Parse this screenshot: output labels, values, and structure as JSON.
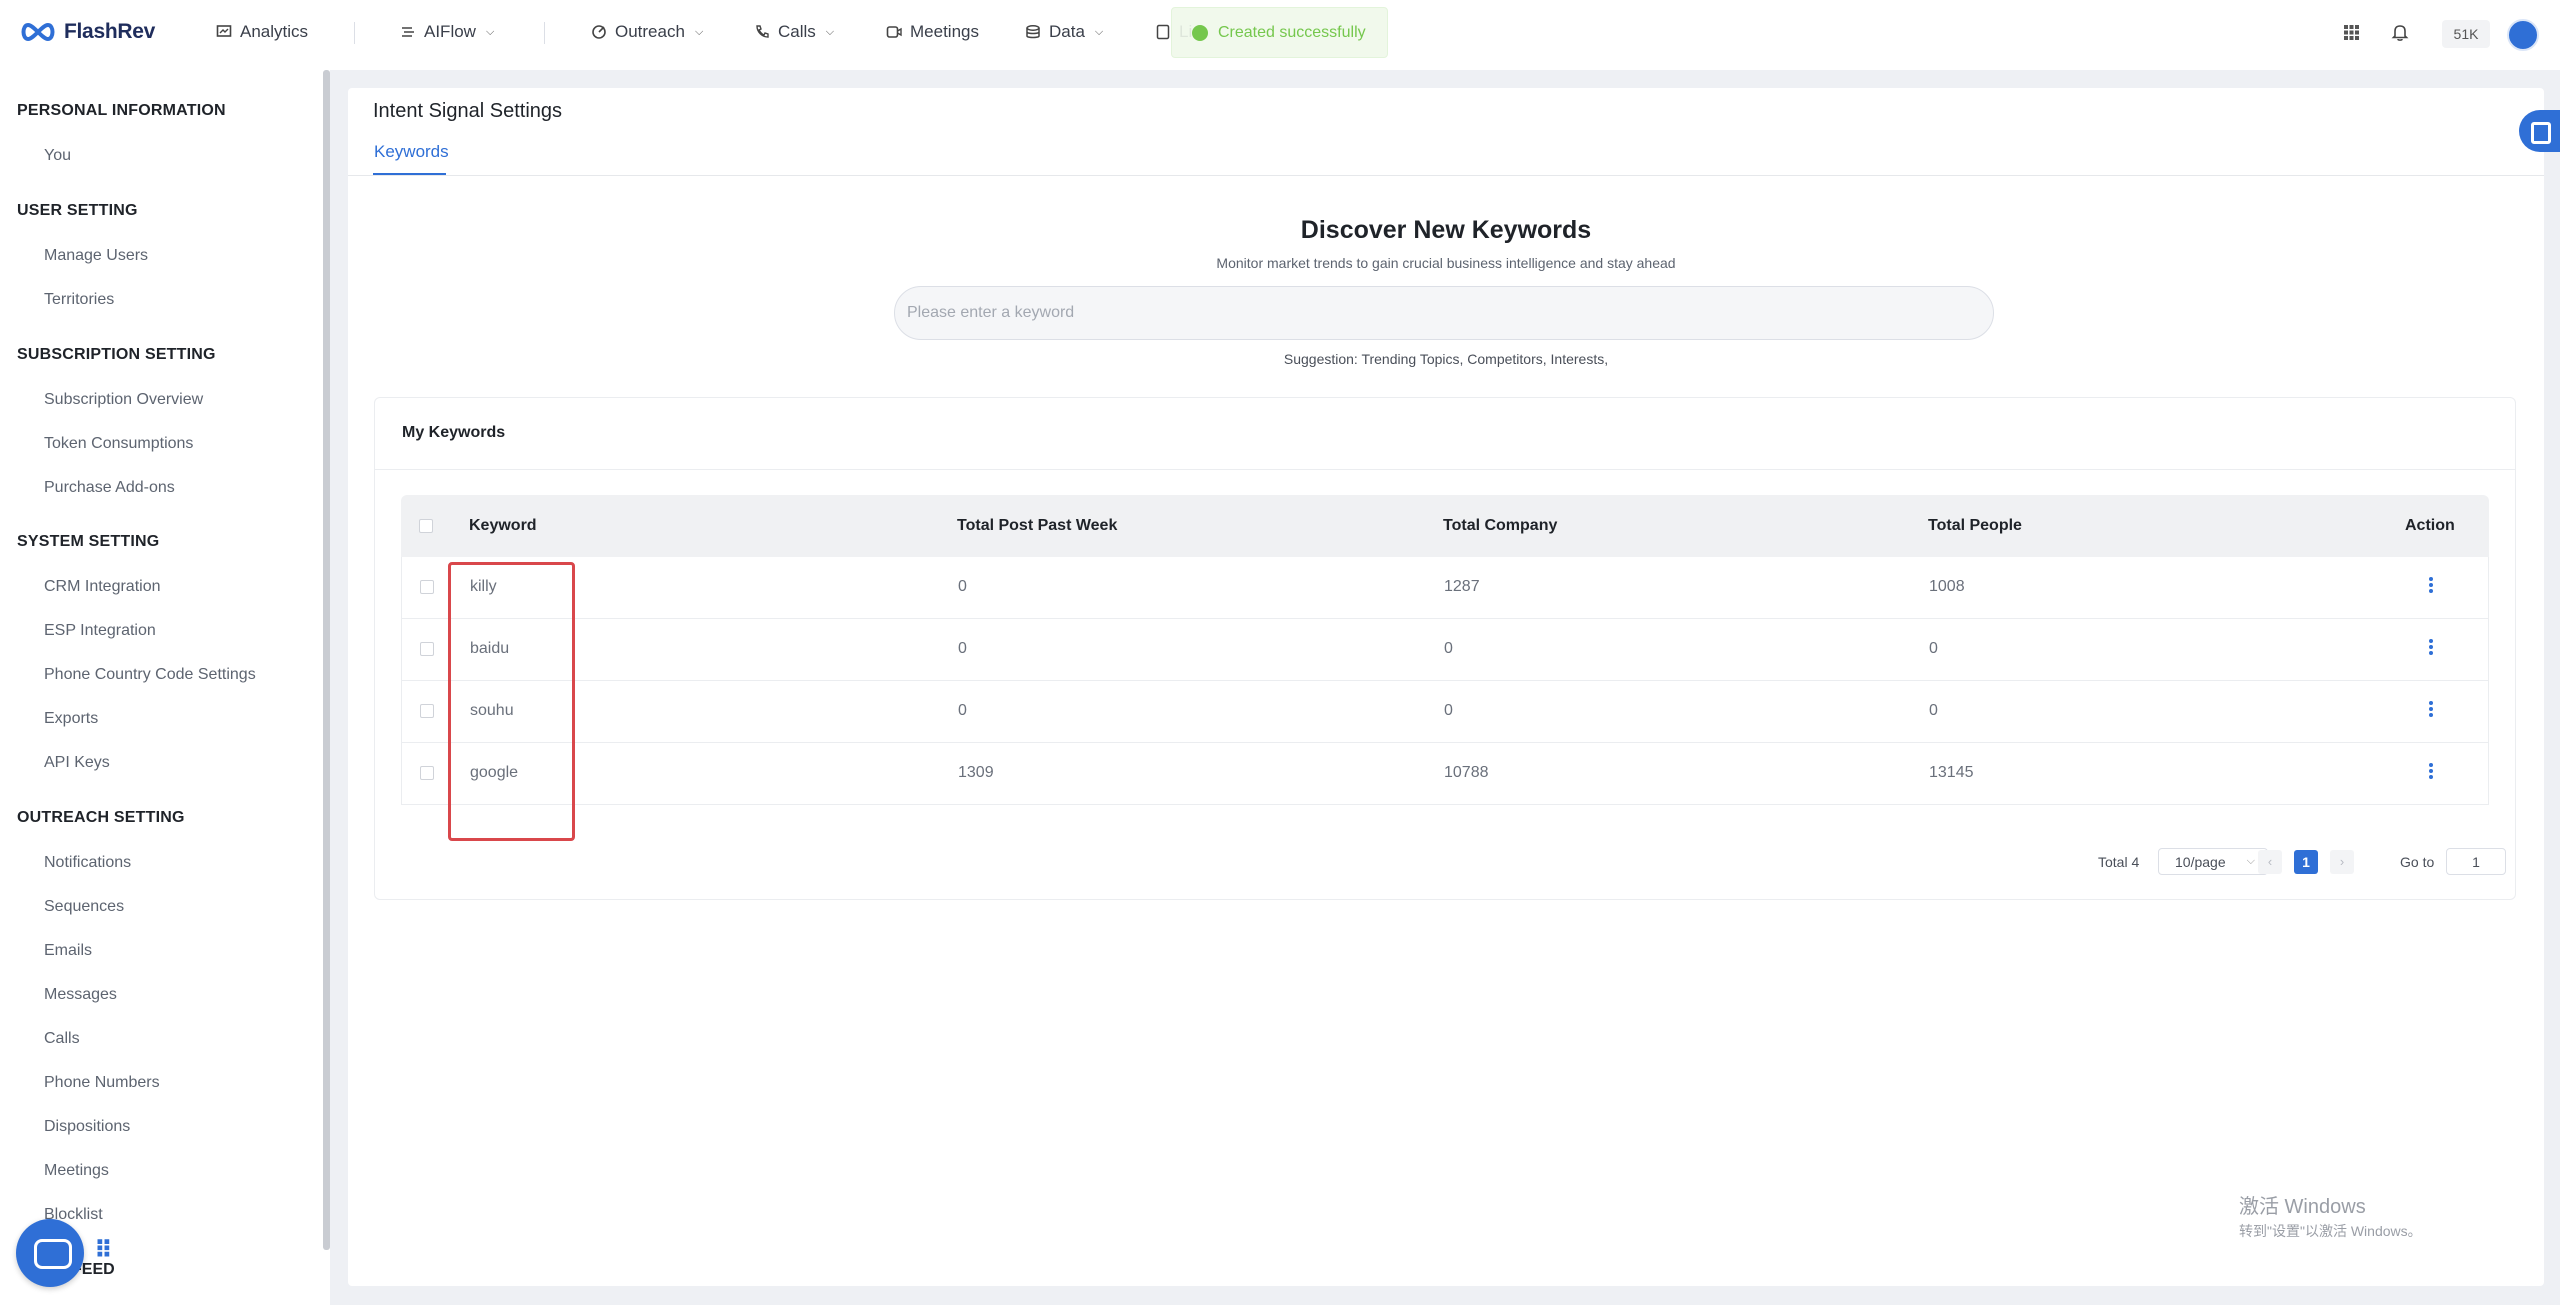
{
  "app": {
    "brand": "FlashRev"
  },
  "nav": {
    "items": [
      {
        "label": "Analytics",
        "icon": "analytics-icon"
      },
      {
        "label": "AIFlow",
        "icon": "aiflow-icon"
      },
      {
        "label": "Outreach",
        "icon": "outreach-icon"
      },
      {
        "label": "Calls",
        "icon": "phone-icon"
      },
      {
        "label": "Meetings",
        "icon": "video-icon"
      },
      {
        "label": "Data",
        "icon": "database-icon"
      },
      {
        "label": "Li",
        "icon": "list-icon"
      }
    ],
    "credits": "51K"
  },
  "toast": {
    "message": "Created successfully"
  },
  "sidebar": {
    "sections": [
      {
        "title": "PERSONAL INFORMATION",
        "items": [
          "You"
        ]
      },
      {
        "title": "USER SETTING",
        "items": [
          "Manage Users",
          "Territories"
        ]
      },
      {
        "title": "SUBSCRIPTION SETTING",
        "items": [
          "Subscription Overview",
          "Token Consumptions",
          "Purchase Add-ons"
        ]
      },
      {
        "title": "SYSTEM SETTING",
        "items": [
          "CRM Integration",
          "ESP Integration",
          "Phone Country Code Settings",
          "Exports",
          "API Keys"
        ]
      },
      {
        "title": "OUTREACH SETTING",
        "items": [
          "Notifications",
          "Sequences",
          "Emails",
          "Messages",
          "Calls",
          "Phone Numbers",
          "Dispositions",
          "Meetings",
          "Blocklist"
        ]
      }
    ],
    "bottom_partial": "FEED"
  },
  "page": {
    "title": "Intent Signal Settings",
    "tab": "Keywords",
    "discover_title": "Discover New Keywords",
    "discover_subtitle": "Monitor market trends to gain crucial business intelligence and stay ahead",
    "search_placeholder": "Please enter a keyword",
    "suggestion": "Suggestion: Trending Topics, Competitors, Interests,"
  },
  "keywords_card": {
    "title": "My Keywords",
    "columns": [
      "Keyword",
      "Total Post Past Week",
      "Total Company",
      "Total People",
      "Action"
    ],
    "rows": [
      {
        "keyword": "killy",
        "posts": "0",
        "companies": "1287",
        "people": "1008"
      },
      {
        "keyword": "baidu",
        "posts": "0",
        "companies": "0",
        "people": "0"
      },
      {
        "keyword": "souhu",
        "posts": "0",
        "companies": "0",
        "people": "0"
      },
      {
        "keyword": "google",
        "posts": "1309",
        "companies": "10788",
        "people": "13145"
      }
    ],
    "pagination": {
      "total": "Total 4",
      "page_size": "10/page",
      "current_page": "1",
      "goto_label": "Go to",
      "goto_value": "1"
    }
  },
  "watermark": {
    "line1": "激活 Windows",
    "line2": "转到\"设置\"以激活 Windows。"
  },
  "colors": {
    "accent": "#2f6fd6",
    "highlight": "#d9474b",
    "success": "#67c23a"
  }
}
